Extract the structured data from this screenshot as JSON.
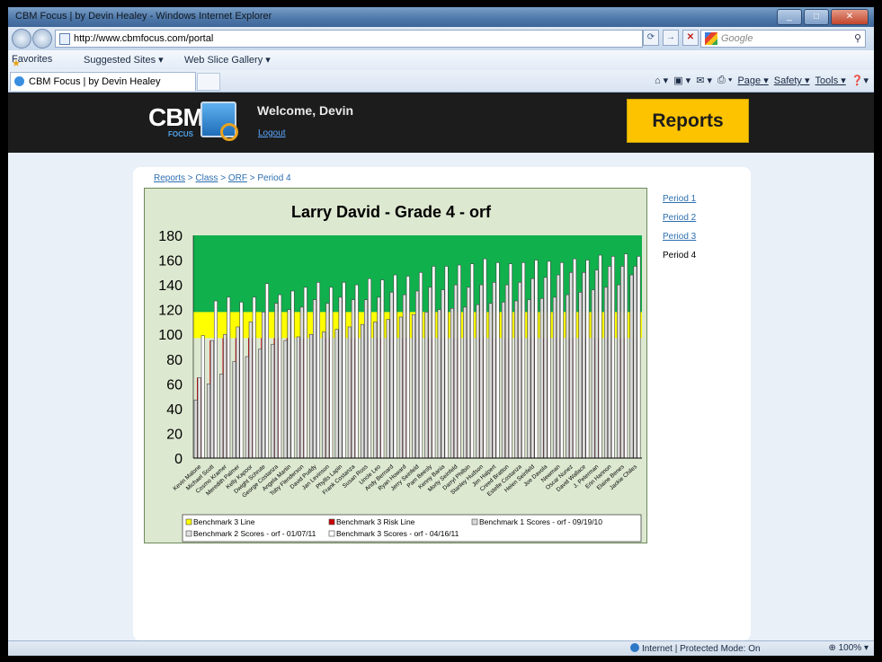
{
  "window": {
    "title": "CBM Focus | by Devin Healey - Windows Internet Explorer"
  },
  "address_bar": {
    "url": "http://www.cbmfocus.com/portal",
    "search_placeholder": "Google"
  },
  "favorites_bar": {
    "favorites": "Favorites",
    "suggested": "Suggested Sites ▾",
    "webslice": "Web Slice Gallery ▾"
  },
  "tab": {
    "label": "CBM Focus | by Devin Healey"
  },
  "command_bar": {
    "page": "Page ▾",
    "safety": "Safety ▾",
    "tools": "Tools ▾"
  },
  "site": {
    "logo_text": "CBM",
    "logo_sub": "FOCUS",
    "welcome": "Welcome, Devin",
    "logout": "Logout",
    "reports_button": "Reports"
  },
  "breadcrumb": {
    "reports": "Reports",
    "sep": ">",
    "class": "Class",
    "orf": "ORF",
    "current": "Period 4"
  },
  "periods": [
    "Period 1",
    "Period 2",
    "Period 3",
    "Period 4"
  ],
  "status": {
    "zone": "Internet | Protected Mode: On",
    "zoom": "100%"
  },
  "colors": {
    "green_zone": "#10b04c",
    "yellow_zone": "#ffff00",
    "red_zone": "#cc0000",
    "chart_bg": "#dde8d0",
    "reports_btn": "#fdc300"
  },
  "chart_data": {
    "type": "bar",
    "title": "Larry David - Grade 4 - orf",
    "ylim": [
      0,
      180
    ],
    "yticks": [
      0,
      20,
      40,
      60,
      80,
      100,
      120,
      140,
      160,
      180
    ],
    "benchmark_bands": {
      "green_top": 180,
      "yellow_top": 118,
      "red_top": 97
    },
    "categories": [
      "Kevin Malone",
      "Michael Scott",
      "Cosmo Kramer",
      "Meredith Palmer",
      "Kelly Kapoor",
      "Dwight Schrute",
      "George Costanza",
      "Angela Martin",
      "Toby Flenderson",
      "David Puddy",
      "Jan Levinson",
      "Phyllis Lapin",
      "Frank Costanza",
      "Susan Ross",
      "Uncle Leo",
      "Andy Bernard",
      "Ryan Howard",
      "Jerry Seinfeld",
      "Pam Beesly",
      "Kenny Bania",
      "Morty Seinfeld",
      "Darryl Philbin",
      "Stanley Hudson",
      "Jim Halpert",
      "Creed Bratton",
      "Estelle Costanza",
      "Helen Seinfeld",
      "Joe Davola",
      "Newman",
      "Oscar Nunez",
      "David Wallace",
      "J. Peterman",
      "Erin Hannon",
      "Elaine Benes",
      "Jackie Chiles"
    ],
    "series": [
      {
        "name": "Benchmark 1 Scores - orf - 09/19/10",
        "color": "#d9d9d9",
        "values": [
          47,
          60,
          68,
          78,
          82,
          88,
          92,
          95,
          98,
          100,
          102,
          104,
          106,
          108,
          110,
          112,
          114,
          116,
          118,
          120,
          121,
          122,
          124,
          125,
          126,
          127,
          128,
          129,
          130,
          132,
          134,
          136,
          138,
          140,
          148
        ]
      },
      {
        "name": "Benchmark 2 Scores - orf - 01/07/11",
        "color": "#e0e0e0",
        "values": [
          65,
          95,
          100,
          106,
          110,
          118,
          125,
          120,
          122,
          128,
          125,
          130,
          128,
          128,
          130,
          134,
          132,
          135,
          138,
          136,
          140,
          138,
          140,
          142,
          140,
          142,
          145,
          146,
          148,
          150,
          150,
          152,
          155,
          155,
          155
        ]
      },
      {
        "name": "Benchmark 3 Scores - orf - 04/16/11",
        "color": "#ffffff",
        "values": [
          99,
          127,
          130,
          126,
          130,
          141,
          132,
          135,
          138,
          142,
          138,
          142,
          140,
          145,
          144,
          148,
          147,
          150,
          155,
          155,
          156,
          157,
          161,
          158,
          157,
          158,
          160,
          159,
          158,
          161,
          160,
          164,
          163,
          165,
          163
        ]
      }
    ],
    "legend": [
      "Benchmark 3 Line",
      "Benchmark 3 Risk Line",
      "Benchmark 1 Scores - orf - 09/19/10",
      "Benchmark 2 Scores - orf - 01/07/11",
      "Benchmark 3 Scores - orf - 04/16/11"
    ]
  }
}
